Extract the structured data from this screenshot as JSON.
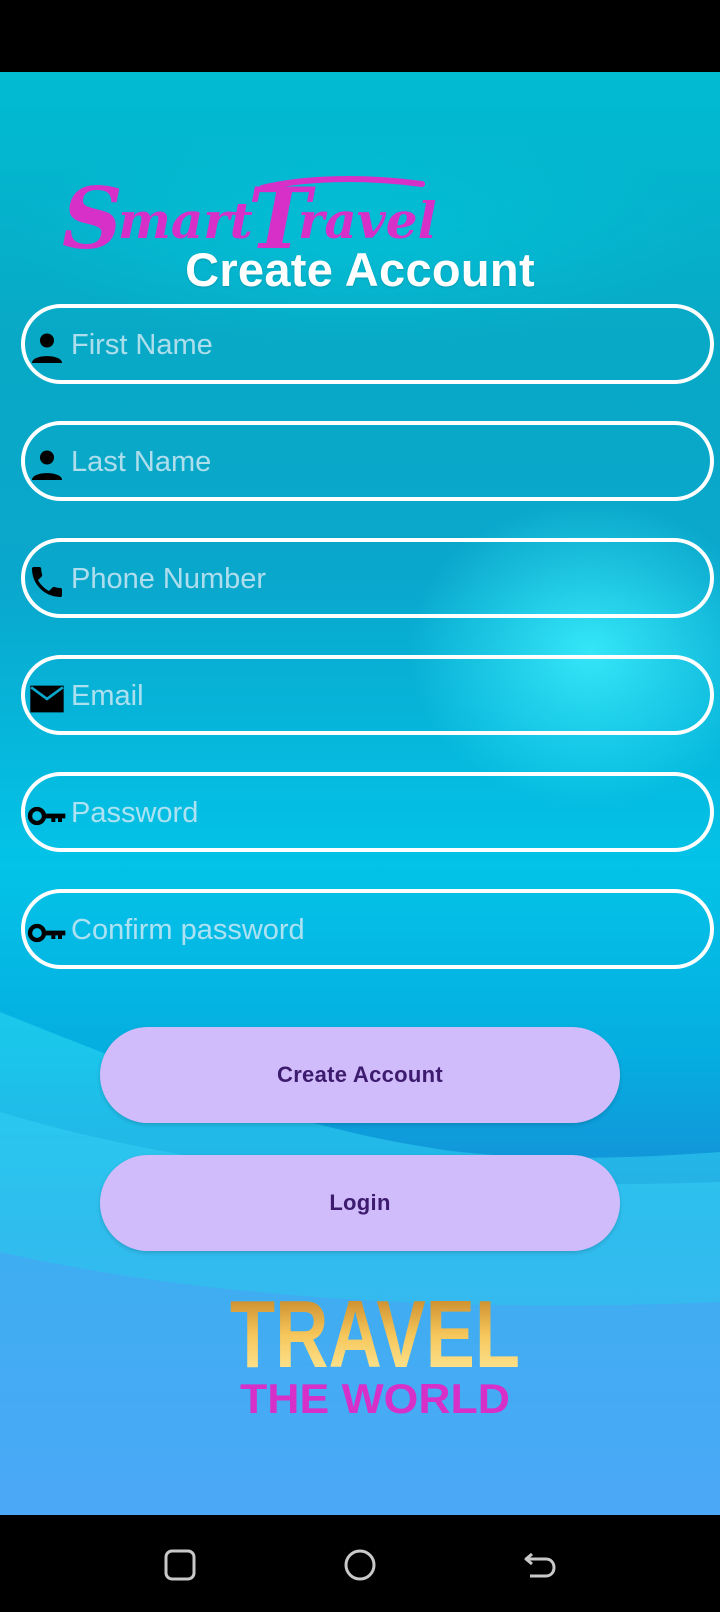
{
  "logo": {
    "smart_travel": "Smart Travel"
  },
  "title": "Create Account",
  "fields": [
    {
      "name": "first-name",
      "placeholder": "First Name",
      "icon": "person-icon"
    },
    {
      "name": "last-name",
      "placeholder": "Last Name",
      "icon": "person-icon"
    },
    {
      "name": "phone-number",
      "placeholder": "Phone Number",
      "icon": "phone-icon"
    },
    {
      "name": "email",
      "placeholder": "Email",
      "icon": "mail-icon"
    },
    {
      "name": "password",
      "placeholder": "Password",
      "icon": "key-icon"
    },
    {
      "name": "confirm-password",
      "placeholder": "Confirm password",
      "icon": "key-icon"
    }
  ],
  "buttons": {
    "create_account": "Create Account",
    "login": "Login"
  },
  "footer_logo": {
    "line1": "TRAVEL",
    "line2": "THE WORLD"
  },
  "colors": {
    "button_bg": "#d1bcfb",
    "button_text": "#3d1b6e",
    "logo_pink": "#d630c8",
    "logo_gold": "#e0a526"
  },
  "nav": {
    "recents": "recents-icon",
    "home": "home-icon",
    "back": "back-icon"
  }
}
